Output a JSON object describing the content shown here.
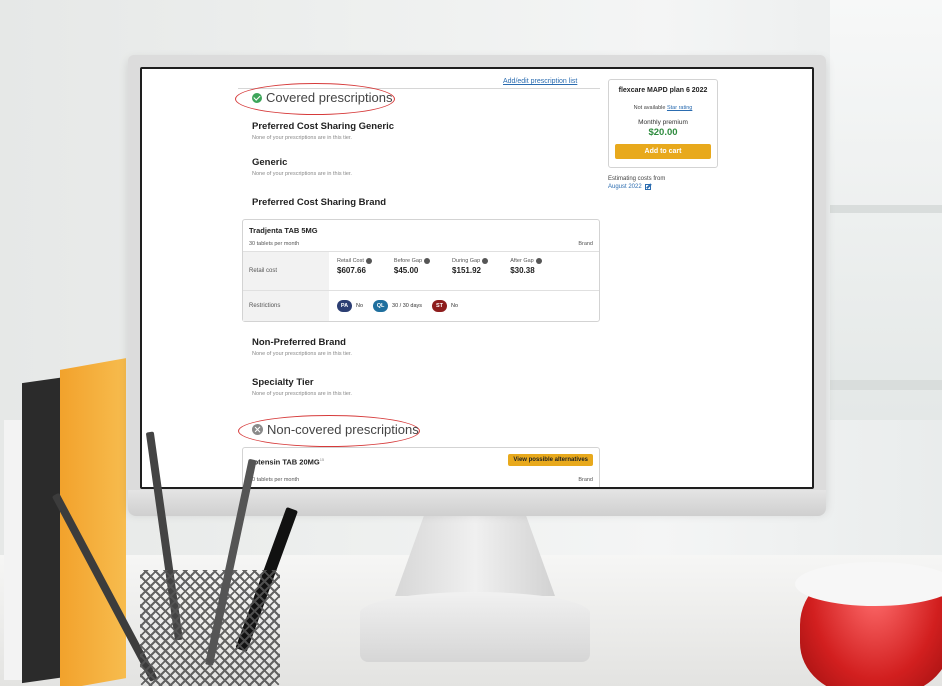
{
  "header": {
    "edit_link": "Add/edit prescription list"
  },
  "covered": {
    "title": "Covered prescriptions",
    "tiers": [
      {
        "name": "Preferred Cost Sharing Generic",
        "note": "None of your prescriptions are in this tier."
      },
      {
        "name": "Generic",
        "note": "None of your prescriptions are in this tier."
      },
      {
        "name": "Preferred Cost Sharing Brand",
        "note": ""
      }
    ],
    "drug": {
      "name": "Tradjenta TAB 5MG",
      "quantity": "30 tablets per month",
      "type": "Brand",
      "retail_row_label": "Retail cost",
      "costs": [
        {
          "label": "Retail Cost",
          "value": "$607.66"
        },
        {
          "label": "Before Gap",
          "value": "$45.00"
        },
        {
          "label": "During Gap",
          "value": "$151.92"
        },
        {
          "label": "After Gap",
          "value": "$30.38"
        }
      ],
      "restrictions_row_label": "Restrictions",
      "restrictions": [
        {
          "badge": "PA",
          "value": "No",
          "color": "#2c3e73"
        },
        {
          "badge": "QL",
          "value": "30 / 30 days",
          "color": "#1f6f9e"
        },
        {
          "badge": "ST",
          "value": "No",
          "color": "#8e1d1d"
        }
      ]
    },
    "more_tiers": [
      {
        "name": "Non-Preferred Brand",
        "note": "None of your prescriptions are in this tier."
      },
      {
        "name": "Specialty Tier",
        "note": "None of your prescriptions are in this tier."
      }
    ]
  },
  "non_covered": {
    "title": "Non-covered prescriptions",
    "drug": {
      "name": "Lotensin TAB 20MG",
      "superscript": "15",
      "quantity": "30 tablets per month",
      "type": "Brand",
      "button": "View possible alternatives"
    }
  },
  "plan": {
    "name": "flexcare MAPD plan 6 2022",
    "star_prefix": "Not available",
    "star_link": "Star rating",
    "premium_label": "Monthly premium",
    "premium_value": "$20.00",
    "cart_button": "Add to cart",
    "estimate_label": "Estimating costs from",
    "estimate_date": "August 2022"
  }
}
